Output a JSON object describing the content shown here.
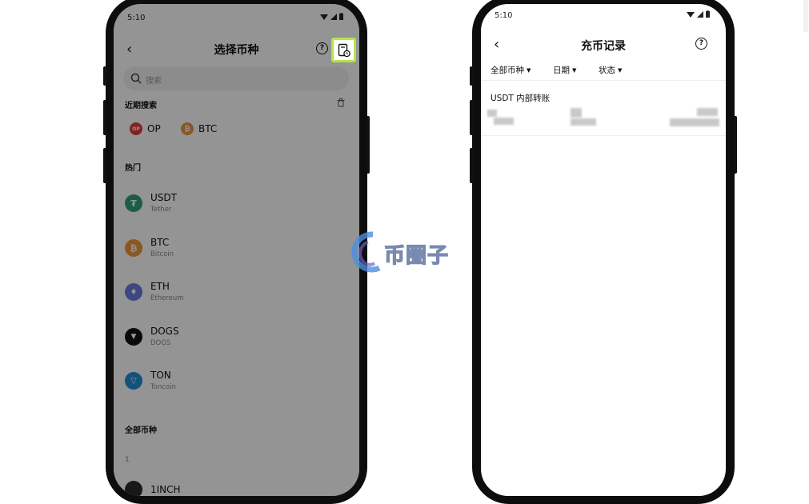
{
  "left_screen": {
    "status_time": "5:10",
    "title": "选择币种",
    "search_placeholder": "搜索",
    "recent_label": "近期搜索",
    "recent": [
      {
        "label": "OP",
        "icon": "op-coin-icon",
        "color": "#e03b3b"
      },
      {
        "label": "BTC",
        "icon": "btc-coin-icon",
        "color": "#f0963c"
      }
    ],
    "hot_label": "热门",
    "hot": [
      {
        "symbol": "USDT",
        "name": "Tether",
        "glyph": "₮",
        "color": "#2fa17a"
      },
      {
        "symbol": "BTC",
        "name": "Bitcoin",
        "glyph": "₿",
        "color": "#f0963c"
      },
      {
        "symbol": "ETH",
        "name": "Ethereum",
        "glyph": "♦",
        "color": "#6a7de0"
      },
      {
        "symbol": "DOGS",
        "name": "DOGS",
        "glyph": "▼",
        "color": "#111111"
      },
      {
        "symbol": "TON",
        "name": "Toncoin",
        "glyph": "▽",
        "color": "#1f8dd6"
      }
    ],
    "all_label": "全部币种",
    "index_letter": "1",
    "first_all": "1INCH",
    "highlight_color": "#b8e24a"
  },
  "right_screen": {
    "status_time": "5:10",
    "title": "充币记录",
    "filters": [
      "全部币种",
      "日期",
      "状态"
    ],
    "record_title": "USDT 内部转账"
  },
  "watermark": "币圈子"
}
